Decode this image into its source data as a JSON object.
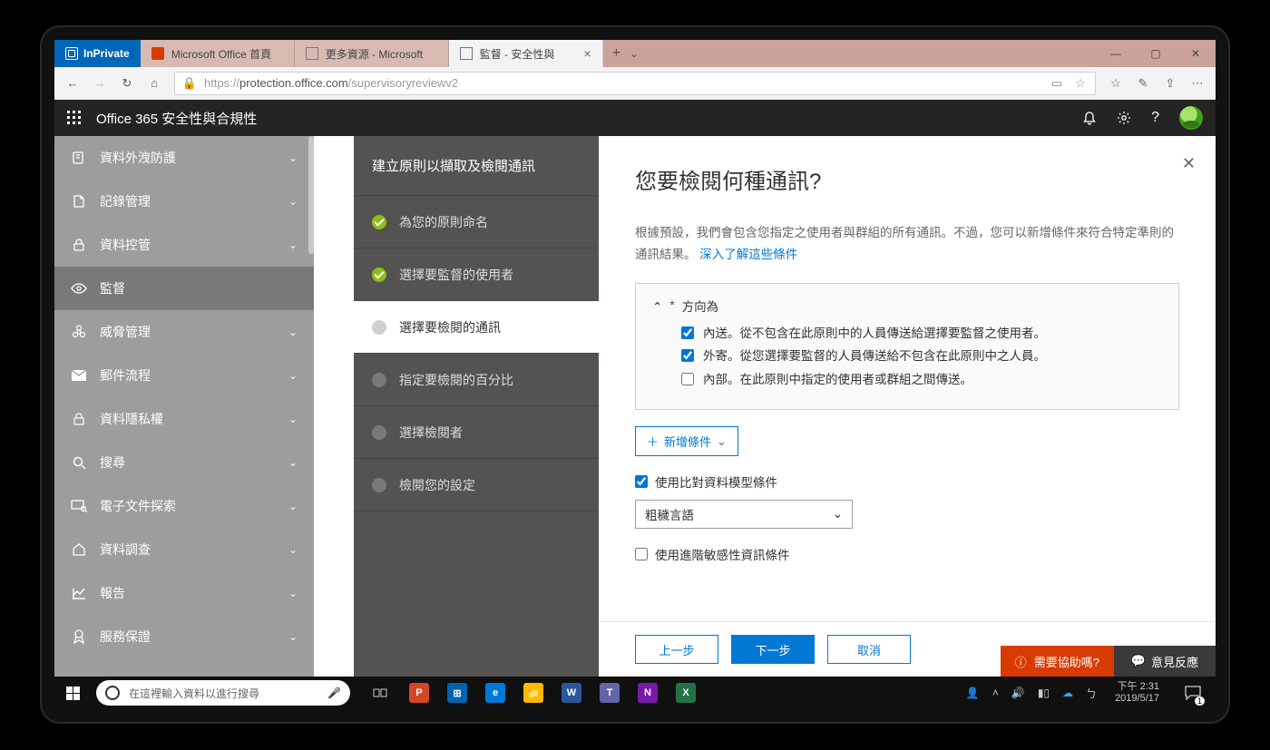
{
  "browser": {
    "inprivate_label": "InPrivate",
    "tabs": [
      {
        "label": "Microsoft Office 首頁"
      },
      {
        "label": "更多資源 - Microsoft"
      },
      {
        "label": "監督 - 安全性與"
      }
    ],
    "url_host": "protection.office.com",
    "url_path": "/supervisoryreviewv2",
    "url_prefix": "https://"
  },
  "suite": {
    "title": "Office 365 安全性與合規性"
  },
  "leftnav": {
    "items": [
      {
        "label": "資料外洩防護",
        "expandable": true
      },
      {
        "label": "記錄管理",
        "expandable": true
      },
      {
        "label": "資料控管",
        "expandable": true
      },
      {
        "label": "監督",
        "expandable": false,
        "active": true
      },
      {
        "label": "威脅管理",
        "expandable": true
      },
      {
        "label": "郵件流程",
        "expandable": true
      },
      {
        "label": "資料隱私權",
        "expandable": true
      },
      {
        "label": "搜尋",
        "expandable": true
      },
      {
        "label": "電子文件探索",
        "expandable": true
      },
      {
        "label": "資料調查",
        "expandable": true
      },
      {
        "label": "報告",
        "expandable": true
      },
      {
        "label": "服務保證",
        "expandable": true
      }
    ]
  },
  "wizard": {
    "title": "建立原則以擷取及檢閱通訊",
    "steps": [
      {
        "label": "為您的原則命名",
        "state": "done"
      },
      {
        "label": "選擇要監督的使用者",
        "state": "done"
      },
      {
        "label": "選擇要檢閱的通訊",
        "state": "current"
      },
      {
        "label": "指定要檢閱的百分比",
        "state": "todo"
      },
      {
        "label": "選擇檢閱者",
        "state": "todo"
      },
      {
        "label": "檢閱您的設定",
        "state": "todo"
      }
    ]
  },
  "panel": {
    "heading": "您要檢閱何種通訊?",
    "hint_pre": "根據預設，我們會包含您指定之使用者與群組的所有通訊。不過，您可以新增條件來符合特定準則的通訊結果。",
    "hint_link": "深入了解這些條件",
    "section_direction": "方向為",
    "dir_inbound": "內送。從不包含在此原則中的人員傳送給選擇要監督之使用者。",
    "dir_outbound": "外寄。從您選擇要監督的人員傳送給不包含在此原則中之人員。",
    "dir_internal": "內部。在此原則中指定的使用者或群組之間傳送。",
    "add_condition": "新增條件",
    "use_model_label": "使用比對資料模型條件",
    "model_selected": "粗穢言語",
    "use_sensitive_label": "使用進階敏感性資訊條件",
    "btn_prev": "上一步",
    "btn_next": "下一步",
    "btn_cancel": "取消",
    "help_label": "需要協助嗎?",
    "feedback_label": "意見反應"
  },
  "taskbar": {
    "search_placeholder": "在這裡輸入資料以進行搜尋",
    "time": "下午 2:31",
    "date": "2019/5/17",
    "notif_count": "1"
  }
}
